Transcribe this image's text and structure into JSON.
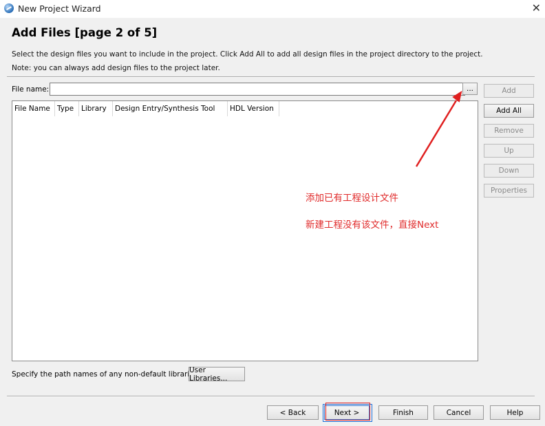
{
  "window": {
    "title": "New Project Wizard",
    "close_glyph": "✕"
  },
  "page": {
    "title": "Add Files [page 2 of 5]",
    "desc_line1": "Select the design files you want to include in the project. Click Add All to add all design files in the project directory to the project.",
    "desc_line2": "Note: you can always add design files to the project later."
  },
  "file_name": {
    "label": "File name:",
    "value": "",
    "browse_label": "..."
  },
  "side_buttons": {
    "add": "Add",
    "add_all": "Add All",
    "remove": "Remove",
    "up": "Up",
    "down": "Down",
    "properties": "Properties"
  },
  "table": {
    "columns": [
      "File Name",
      "Type",
      "Library",
      "Design Entry/Synthesis Tool",
      "HDL Version"
    ],
    "rows": []
  },
  "annotations": {
    "line1": "添加已有工程设计文件",
    "line2": "新建工程没有该文件，直接Next",
    "color": "#e02a2a"
  },
  "libraries": {
    "label": "Specify the path names of any non-default libraries.",
    "button": "User Libraries..."
  },
  "footer": {
    "back": "< Back",
    "next": "Next >",
    "finish": "Finish",
    "cancel": "Cancel",
    "help": "Help"
  }
}
